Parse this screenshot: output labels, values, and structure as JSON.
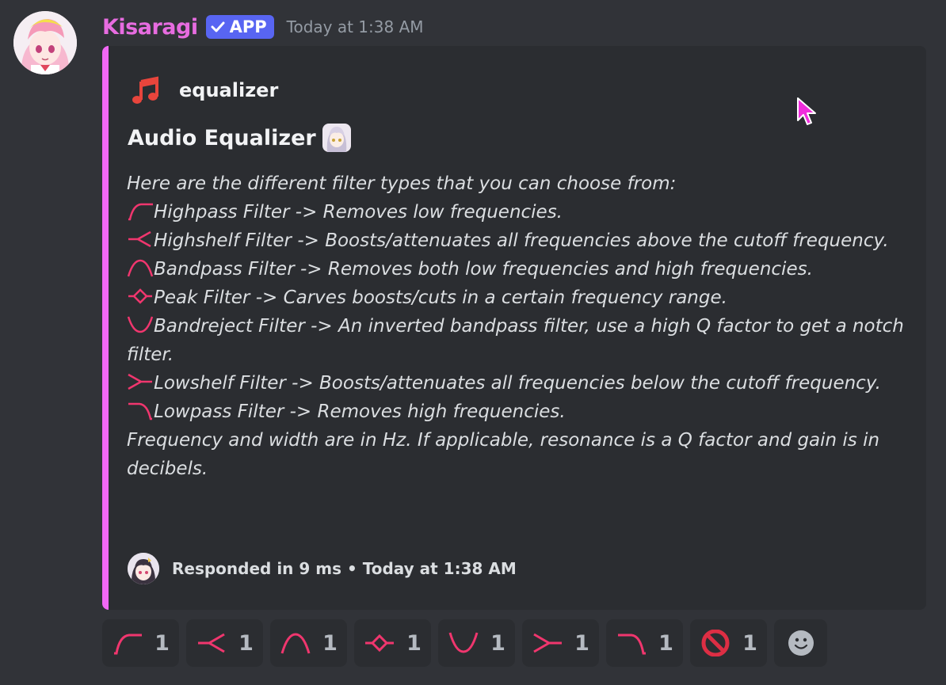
{
  "message": {
    "username": "Kisaragi",
    "badge": "APP",
    "timestamp": "Today at 1:38 AM"
  },
  "embed": {
    "accent_color": "#f168f4",
    "author": "equalizer",
    "title": "Audio Equalizer",
    "intro": "Here are the different filter types that you can choose from:",
    "filters": [
      {
        "icon": "highpass-icon",
        "text": "Highpass Filter -> Removes low frequencies."
      },
      {
        "icon": "highshelf-icon",
        "text": "Highshelf Filter -> Boosts/attenuates all frequencies above the cutoff frequency."
      },
      {
        "icon": "bandpass-icon",
        "text": "Bandpass Filter -> Removes both low frequencies and high frequencies."
      },
      {
        "icon": "peak-icon",
        "text": "Peak Filter -> Carves boosts/cuts in a certain frequency range."
      },
      {
        "icon": "bandreject-icon",
        "text": "Bandreject Filter -> An inverted bandpass filter, use a high Q factor to get a notch filter."
      },
      {
        "icon": "lowshelf-icon",
        "text": "Lowshelf Filter -> Boosts/attenuates all frequencies below the cutoff frequency."
      },
      {
        "icon": "lowpass-icon",
        "text": "Lowpass Filter -> Removes high frequencies."
      }
    ],
    "outro": "Frequency and width are in Hz. If applicable, resonance is a Q factor and gain is in decibels.",
    "footer": "Responded in 9 ms • Today at 1:38 AM"
  },
  "reactions": [
    {
      "icon": "highpass-icon",
      "count": "1"
    },
    {
      "icon": "highshelf-icon",
      "count": "1"
    },
    {
      "icon": "bandpass-icon",
      "count": "1"
    },
    {
      "icon": "peak-icon",
      "count": "1"
    },
    {
      "icon": "bandreject-icon",
      "count": "1"
    },
    {
      "icon": "lowshelf-icon",
      "count": "1"
    },
    {
      "icon": "lowpass-icon",
      "count": "1"
    },
    {
      "icon": "no-entry-icon",
      "count": "1"
    }
  ],
  "add_reaction_icon": "smiley-face-icon",
  "colors": {
    "background": "#313338",
    "embed_background": "#2b2d31",
    "username": "#e76ce0",
    "badge": "#5865f2",
    "filter_icon": "#f0366e"
  }
}
